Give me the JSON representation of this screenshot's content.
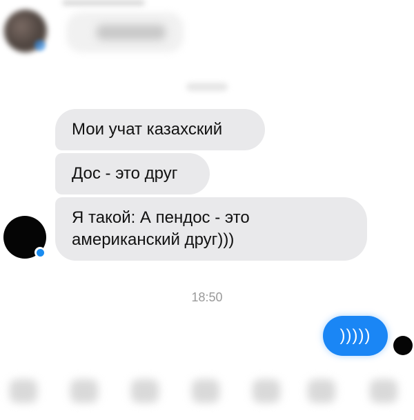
{
  "conversation": {
    "messages_in": [
      {
        "text": "Мои учат казахский"
      },
      {
        "text": "Дос - это друг"
      },
      {
        "lines": [
          "Я такой: А пендос - это",
          "американский друг)))"
        ]
      }
    ],
    "time_divider": "18:50",
    "message_out": {
      "text": ")))))"
    }
  },
  "colors": {
    "incoming_bubble": "#e9e9eb",
    "outgoing_bubble": "#1a86f5",
    "timestamp": "#9a9a9a",
    "online_badge": "#1a8cf0"
  },
  "toolbar": {
    "icons": [
      "more-icon",
      "camera-icon",
      "photo-icon",
      "microphone-icon",
      "location-icon",
      "sticker-icon",
      "like-icon"
    ]
  }
}
